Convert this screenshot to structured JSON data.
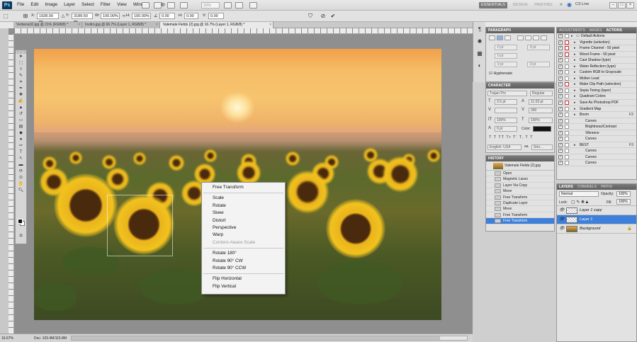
{
  "menubar": {
    "app_logo": "Ps",
    "items": [
      "File",
      "Edit",
      "Image",
      "Layer",
      "Select",
      "Filter",
      "View",
      "Window",
      "Help"
    ],
    "zoom": "33%",
    "workspaces": {
      "essentials": "ESSENTIALS",
      "design": "DESIGN",
      "painting": "PAINTING"
    },
    "cs_live": "CS Live",
    "win_min": "–",
    "win_max": "□",
    "win_close": "×"
  },
  "options_bar": {
    "x_label": "X:",
    "x_value": "1928.00 px",
    "y_label": "Y:",
    "y_value": "3189.50 px",
    "w_label": "W:",
    "w_value": "100.00%",
    "h_label": "H:",
    "h_value": "100.00%",
    "angle_value": "0.00",
    "hskew_label": "H:",
    "hskew_value": "0.00",
    "vskew_label": "V:",
    "vskew_value": "0.00"
  },
  "doc_tabs": [
    {
      "label": "Verbena10.jpg @ 21% (RGB/8) *",
      "x": "×"
    },
    {
      "label": "Invitro.jpg @ 66.7% (Layer 1, RGB/8) *",
      "x": "×"
    },
    {
      "label": "Valemale Fields (2).jpg @ 16.7% (Layer 1, RGB/8) *",
      "x": "×"
    }
  ],
  "context_menu": {
    "items": [
      {
        "label": "Free Transform",
        "disabled": false
      },
      {
        "sep": true
      },
      {
        "label": "Scale",
        "disabled": false
      },
      {
        "label": "Rotate",
        "disabled": false
      },
      {
        "label": "Skew",
        "disabled": false
      },
      {
        "label": "Distort",
        "disabled": false
      },
      {
        "label": "Perspective",
        "disabled": false
      },
      {
        "label": "Warp",
        "disabled": false
      },
      {
        "label": "Content-Aware Scale",
        "disabled": true
      },
      {
        "sep": true
      },
      {
        "label": "Rotate 180°",
        "disabled": false
      },
      {
        "label": "Rotate 90° CW",
        "disabled": false
      },
      {
        "label": "Rotate 90° CCW",
        "disabled": false
      },
      {
        "sep": true
      },
      {
        "label": "Flip Horizontal",
        "disabled": false
      },
      {
        "label": "Flip Vertical",
        "disabled": false
      }
    ]
  },
  "status_bar": {
    "zoom": "16.67%",
    "doc": "Doc: 103.4M/115.8M"
  },
  "paragraph": {
    "tab": "PARAGRAPH",
    "field_value": "0 pt",
    "hyphenate": "Hyphenate"
  },
  "character": {
    "tab": "CHARACTER",
    "font": "Trajan Pro",
    "style": "Regular",
    "size": "3.5 pt",
    "leading": "11.03 pt",
    "tracking": "300",
    "scale_v": "100%",
    "scale_h": "100%",
    "baseline": "0 pt",
    "color_label": "Color:",
    "style_buttons": "T T TT Tr T' T, T T",
    "language": "English: USA",
    "aa": "Stro..."
  },
  "history": {
    "tab": "HISTORY",
    "snapshot": "Valemale Fields (2).jpg",
    "items": [
      "Open",
      "Magnetic Lasso",
      "Layer Via Copy",
      "Move",
      "Free Transform",
      "Duplicate Layer",
      "Move",
      "Free Transform",
      "Free Transform"
    ],
    "selected_index": 8
  },
  "actions": {
    "tabs": [
      "ADJUSTMENTS",
      "MASKS",
      "ACTIONS"
    ],
    "rows": [
      {
        "label": "Default Actions",
        "level": 0,
        "folder": true,
        "red": false
      },
      {
        "label": "Vignette (selection)",
        "level": 1,
        "red": true
      },
      {
        "label": "Frame Channel - 50 pixel",
        "level": 1,
        "red": true
      },
      {
        "label": "Wood Frame - 50 pixel",
        "level": 1,
        "red": true
      },
      {
        "label": "Cast Shadow (type)",
        "level": 1,
        "red": false
      },
      {
        "label": "Water Reflection (type)",
        "level": 1,
        "red": false
      },
      {
        "label": "Custom RGB to Grayscale",
        "level": 1,
        "red": false
      },
      {
        "label": "Molten Lead",
        "level": 1,
        "red": false
      },
      {
        "label": "Make Clip Path (selection)",
        "level": 1,
        "red": true
      },
      {
        "label": "Sepia Toning (layer)",
        "level": 1,
        "red": false
      },
      {
        "label": "Quadrant Colors",
        "level": 1,
        "red": false
      },
      {
        "label": "Save As Photoshop PDF",
        "level": 1,
        "red": true
      },
      {
        "label": "Gradient Map",
        "level": 1,
        "red": false
      },
      {
        "label": "Boom",
        "level": 1,
        "key": "F2",
        "red": false
      },
      {
        "label": "Curves",
        "level": 2,
        "red": false
      },
      {
        "label": "Brightness/Contrast",
        "level": 2,
        "red": false
      },
      {
        "label": "Vibrance",
        "level": 2,
        "red": false
      },
      {
        "label": "Curves",
        "level": 2,
        "red": false
      },
      {
        "label": "BEST",
        "level": 1,
        "key": "F3",
        "red": false
      },
      {
        "label": "Curves",
        "level": 2,
        "red": false
      },
      {
        "label": "Curves",
        "level": 2,
        "red": false
      },
      {
        "label": "Curves",
        "level": 2,
        "red": false
      }
    ]
  },
  "layers": {
    "tabs": [
      "LAYERS",
      "CHANNELS",
      "PATHS"
    ],
    "blend": "Normal",
    "opacity_label": "Opacity:",
    "opacity": "100%",
    "lock_label": "Lock:",
    "fill_label": "Fill:",
    "fill": "100%",
    "items": [
      {
        "name": "Layer 1 copy",
        "selected": false
      },
      {
        "name": "Layer 1",
        "selected": true
      },
      {
        "name": "Background",
        "selected": false,
        "lock": "🔒"
      }
    ]
  },
  "colors": {
    "selection": "#3d7fd9",
    "essentials_bg": "#7a7a7a",
    "panel_header": "#6a6a6a"
  }
}
